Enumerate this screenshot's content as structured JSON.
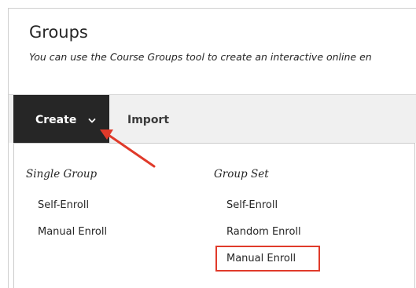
{
  "header": {
    "title": "Groups",
    "description": "You can use the Course Groups tool to create an interactive online en"
  },
  "toolbar": {
    "create_label": "Create",
    "import_label": "Import"
  },
  "dropdown": {
    "single_group": {
      "heading": "Single Group",
      "items": [
        "Self-Enroll",
        "Manual Enroll"
      ]
    },
    "group_set": {
      "heading": "Group Set",
      "items": [
        "Self-Enroll",
        "Random Enroll",
        "Manual Enroll"
      ]
    }
  },
  "colors": {
    "create_button_bg": "#262626",
    "toolbar_bg": "#f0f0f0",
    "annotation_red": "#e03a2a"
  },
  "icons": {
    "create_chevron": "chevron-down-icon",
    "annotation": "arrow-annotation"
  }
}
